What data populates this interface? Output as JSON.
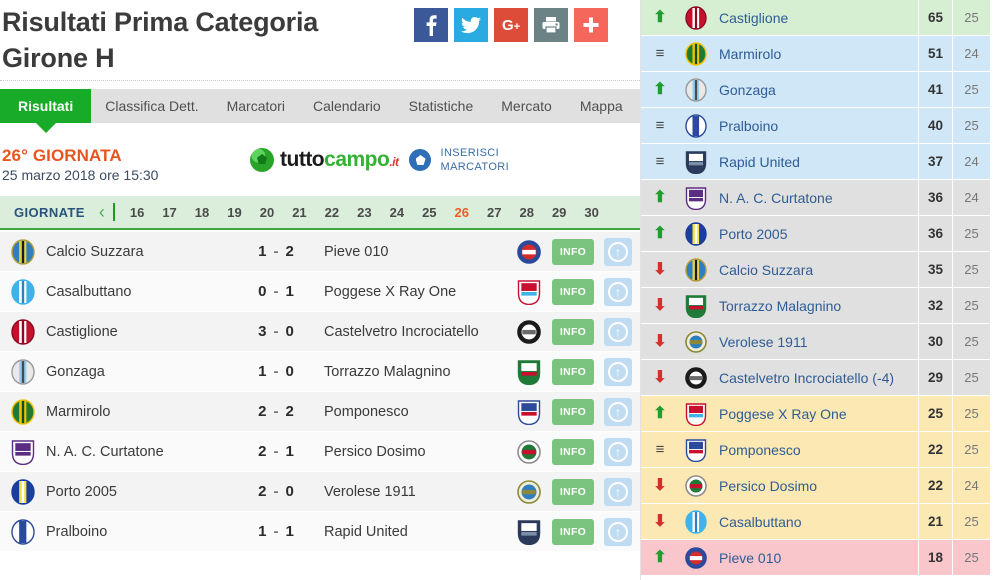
{
  "header": {
    "title_line1": "Risultati Prima Categoria",
    "title_line2": "Girone H",
    "social": [
      {
        "name": "facebook-share-button",
        "label": "f",
        "color": "#3b5998"
      },
      {
        "name": "twitter-share-button",
        "label": "t",
        "color": "#29aae1"
      },
      {
        "name": "google-plus-share-button",
        "label": "G+",
        "color": "#dd4b39"
      },
      {
        "name": "print-button",
        "label": "print",
        "color": "#6b8384"
      },
      {
        "name": "more-share-button",
        "label": "+",
        "color": "#f4675a"
      }
    ]
  },
  "tabs": [
    {
      "label": "Risultati",
      "active": true
    },
    {
      "label": "Classifica Dett.",
      "active": false
    },
    {
      "label": "Marcatori",
      "active": false
    },
    {
      "label": "Calendario",
      "active": false
    },
    {
      "label": "Statistiche",
      "active": false
    },
    {
      "label": "Mercato",
      "active": false
    },
    {
      "label": "Mappa",
      "active": false
    }
  ],
  "matchday": {
    "number_label": "26° GIORNATA",
    "date_label": "25 marzo 2018 ore 15:30"
  },
  "brand": {
    "word_a": "tutto",
    "word_b": "campo",
    "word_c": ".it",
    "insert_line1": "INSERISCI",
    "insert_line2": "MARCATORI"
  },
  "giornate": {
    "label": "GIORNATE",
    "prev_icon": "‹",
    "current": "26",
    "numbers": [
      "16",
      "17",
      "18",
      "19",
      "20",
      "21",
      "22",
      "23",
      "24",
      "25",
      "26",
      "27",
      "28",
      "29",
      "30"
    ]
  },
  "matches": [
    {
      "home": "Calcio Suzzara",
      "home_score": "1",
      "away_score": "2",
      "away": "Pieve 010",
      "info_label": "INFO"
    },
    {
      "home": "Casalbuttano",
      "home_score": "0",
      "away_score": "1",
      "away": "Poggese X Ray One",
      "info_label": "INFO"
    },
    {
      "home": "Castiglione",
      "home_score": "3",
      "away_score": "0",
      "away": "Castelvetro Incrociatello",
      "info_label": "INFO"
    },
    {
      "home": "Gonzaga",
      "home_score": "1",
      "away_score": "0",
      "away": "Torrazzo Malagnino",
      "info_label": "INFO"
    },
    {
      "home": "Marmirolo",
      "home_score": "2",
      "away_score": "2",
      "away": "Pomponesco",
      "info_label": "INFO"
    },
    {
      "home": "N. A. C. Curtatone",
      "home_score": "2",
      "away_score": "1",
      "away": "Persico Dosimo",
      "info_label": "INFO"
    },
    {
      "home": "Porto 2005",
      "home_score": "2",
      "away_score": "0",
      "away": "Verolese 1911",
      "info_label": "INFO"
    },
    {
      "home": "Pralboino",
      "home_score": "1",
      "away_score": "1",
      "away": "Rapid United",
      "info_label": "INFO"
    }
  ],
  "standings": [
    {
      "trend": "up",
      "team": "Castiglione",
      "points": "65",
      "played": "25",
      "zone": "green"
    },
    {
      "trend": "eq",
      "team": "Marmirolo",
      "points": "51",
      "played": "24",
      "zone": "blue"
    },
    {
      "trend": "up",
      "team": "Gonzaga",
      "points": "41",
      "played": "25",
      "zone": "blue"
    },
    {
      "trend": "eq",
      "team": "Pralboino",
      "points": "40",
      "played": "25",
      "zone": "blue"
    },
    {
      "trend": "eq",
      "team": "Rapid United",
      "points": "37",
      "played": "24",
      "zone": "blue"
    },
    {
      "trend": "up",
      "team": "N. A. C. Curtatone",
      "points": "36",
      "played": "24",
      "zone": "grey"
    },
    {
      "trend": "up",
      "team": "Porto 2005",
      "points": "36",
      "played": "25",
      "zone": "grey"
    },
    {
      "trend": "down",
      "team": "Calcio Suzzara",
      "points": "35",
      "played": "25",
      "zone": "grey"
    },
    {
      "trend": "down",
      "team": "Torrazzo Malagnino",
      "points": "32",
      "played": "25",
      "zone": "grey"
    },
    {
      "trend": "down",
      "team": "Verolese 1911",
      "points": "30",
      "played": "25",
      "zone": "grey"
    },
    {
      "trend": "down",
      "team": "Castelvetro Incrociatello (-4)",
      "points": "29",
      "played": "25",
      "zone": "grey"
    },
    {
      "trend": "up",
      "team": "Poggese X Ray One",
      "points": "25",
      "played": "25",
      "zone": "yellow"
    },
    {
      "trend": "eq",
      "team": "Pomponesco",
      "points": "22",
      "played": "25",
      "zone": "yellow"
    },
    {
      "trend": "down",
      "team": "Persico Dosimo",
      "points": "22",
      "played": "24",
      "zone": "yellow"
    },
    {
      "trend": "down",
      "team": "Casalbuttano",
      "points": "21",
      "played": "25",
      "zone": "yellow"
    },
    {
      "trend": "up",
      "team": "Pieve 010",
      "points": "18",
      "played": "25",
      "zone": "red"
    }
  ],
  "colors": {
    "accent_green": "#17ab28",
    "orange": "#e8561f",
    "link_blue": "#2f5c96",
    "info_green": "#7ac47f"
  }
}
